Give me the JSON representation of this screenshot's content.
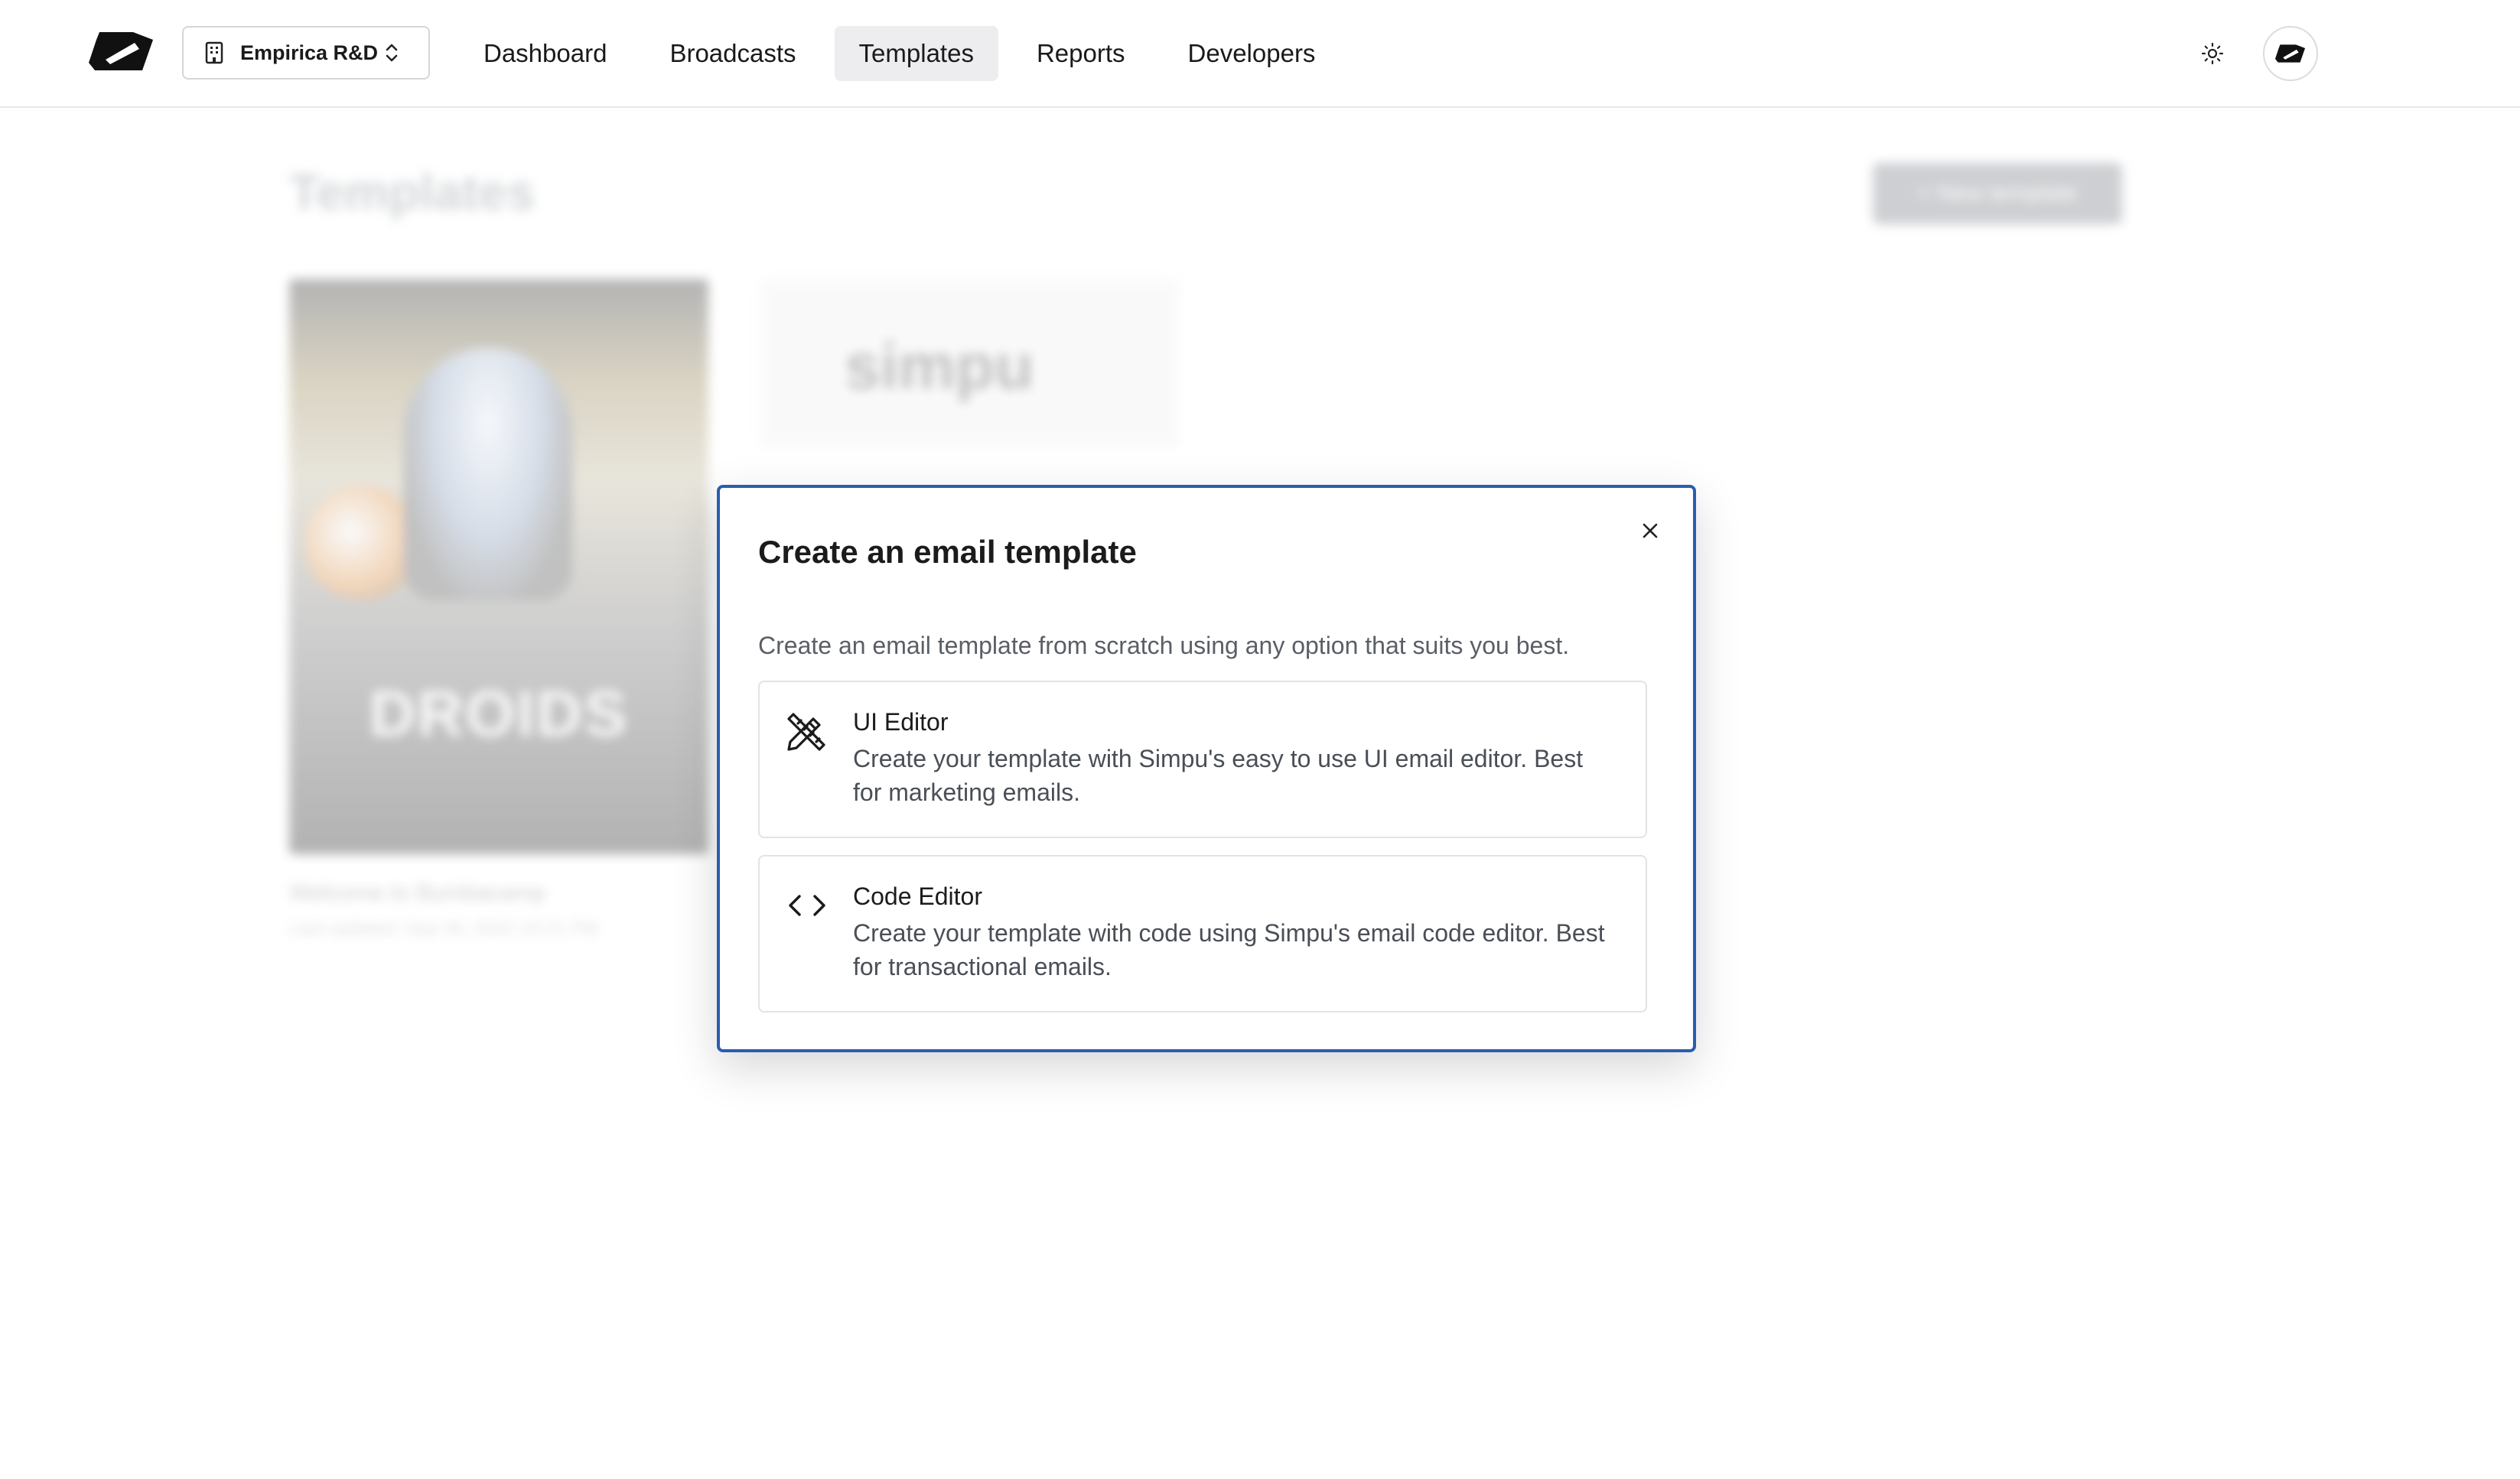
{
  "header": {
    "org_name": "Empirica R&D",
    "nav": [
      {
        "label": "Dashboard",
        "active": false
      },
      {
        "label": "Broadcasts",
        "active": false
      },
      {
        "label": "Templates",
        "active": true
      },
      {
        "label": "Reports",
        "active": false
      },
      {
        "label": "Developers",
        "active": false
      }
    ]
  },
  "background": {
    "page_title": "Templates",
    "new_template_label": "+ New template",
    "card1_image_text": "DROIDS",
    "card1_caption": "Welcome to Bumbacamp",
    "card1_meta": "Last updated: Sep 30, 2022 10:21 PM",
    "card2_brand": "simpu"
  },
  "modal": {
    "title": "Create an email template",
    "description": "Create an email template from scratch using any option that suits you best.",
    "options": [
      {
        "icon": "design-pencil-ruler-icon",
        "title": "UI Editor",
        "description": "Create your template with Simpu's easy to use UI email editor. Best for marketing emails."
      },
      {
        "icon": "code-brackets-icon",
        "title": "Code Editor",
        "description": "Create your template with code using Simpu's email code editor. Best for transactional emails."
      }
    ]
  },
  "colors": {
    "modal_border": "#2a5db0",
    "active_tab_bg": "#ededf0"
  }
}
